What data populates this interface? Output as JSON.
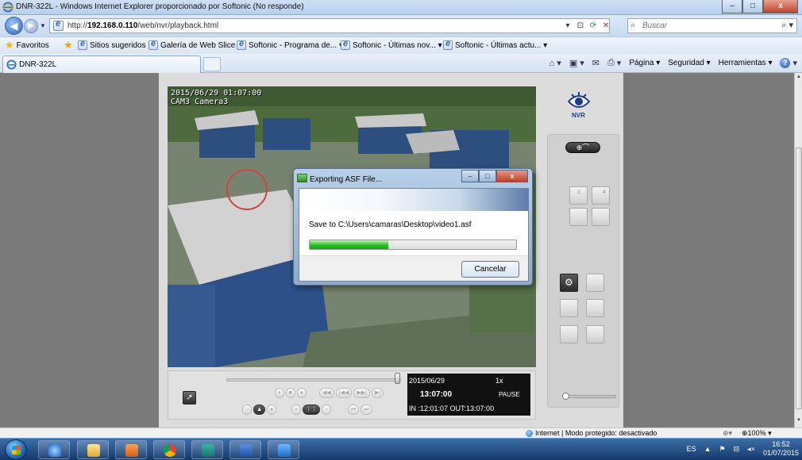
{
  "window": {
    "title": "DNR-322L - Windows Internet Explorer proporcionado por Softonic (No responde)",
    "min": "–",
    "max": "□",
    "close": "x"
  },
  "addressbar": {
    "url_prefix": "http://",
    "url_host": "192.168.0.110",
    "url_path": "/web/nvr/playback.html",
    "search_placeholder": "Buscar"
  },
  "favorites": {
    "label": "Favoritos",
    "items": [
      "Sitios sugeridos ▾",
      "Galería de Web Slice ▾",
      "Softonic - Programa de... ▾",
      "Softonic - Últimas nov... ▾",
      "Softonic - Últimas actu... ▾"
    ]
  },
  "tab": {
    "title": "DNR-322L"
  },
  "commandbar": {
    "page": "Página ▾",
    "safety": "Seguridad ▾",
    "tools": "Herramientas ▾"
  },
  "video": {
    "timestamp": "2015/06/29 01:07:00",
    "camera": "CAM3 Camera3"
  },
  "nvr": {
    "logo_text": "NVR",
    "layout_1": "1",
    "layout_4": "4"
  },
  "playback": {
    "date": "2015/06/29",
    "speed": "1x",
    "time": "13:07:00",
    "state": "PAUSE",
    "in_out": "IN :12:01:07  OUT:13:07:00"
  },
  "dialog": {
    "title": "Exporting ASF File...",
    "message": "Save to C:\\Users\\camaras\\Desktop\\video1.asf",
    "progress": 0.38,
    "cancel": "Cancelar"
  },
  "statusbar": {
    "zone": "Internet | Modo protegido: desactivado",
    "zoom": "100% ▾"
  },
  "taskbar": {
    "lang": "ES",
    "time": "16:52",
    "date": "01/07/2015"
  }
}
